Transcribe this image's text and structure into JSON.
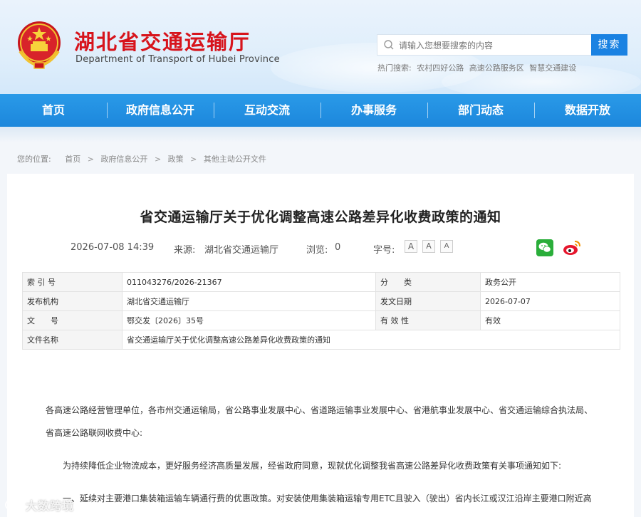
{
  "header": {
    "title": "湖北省交通运输厅",
    "subtitle": "Department of Transport of Hubei Province",
    "search_placeholder": "请输入您想要搜索的内容",
    "search_button": "搜索",
    "hot_label": "热门搜索:",
    "hot_links": [
      "农村四好公路",
      "高速公路服务区",
      "智慧交通建设"
    ]
  },
  "nav": {
    "items": [
      "首页",
      "政府信息公开",
      "互动交流",
      "办事服务",
      "部门动态",
      "数据开放"
    ]
  },
  "breadcrumb": {
    "label": "您的位置:",
    "items": [
      "首页",
      "政府信息公开",
      "政策",
      "其他主动公开文件"
    ],
    "separator": ">"
  },
  "article": {
    "title": "省交通运输厅关于优化调整高速公路差异化收费政策的通知",
    "datetime": "2026-07-08 14:39",
    "source_label": "来源:",
    "source": "湖北省交通运输厅",
    "views_label": "浏览:",
    "views": "0",
    "font_size_label": "字号:",
    "font_sizes": [
      "A",
      "A",
      "A"
    ]
  },
  "info_table": {
    "rows": [
      {
        "label": "索 引 号",
        "value": "011043276/2026-21367",
        "label2": "分　　类",
        "value2": "政务公开"
      },
      {
        "label": "发布机构",
        "value": "湖北省交通运输厅",
        "label2": "发文日期",
        "value2": "2026-07-07"
      },
      {
        "label": "文　　号",
        "value": "鄂交发〔2026〕35号",
        "label2": "有 效 性",
        "value2": "有效"
      }
    ],
    "filename_label": "文件名称",
    "filename": "省交通运输厅关于优化调整高速公路差异化收费政策的通知"
  },
  "body": {
    "p1a": "各高速公路经营管理单位，各市州交通运输局，省公路事业发展中心、省道路运输事业发展中心、省港航事业发展中心、省交通运输综合执法局、",
    "p1b": "省高速公路联网收费中心:",
    "p2": "为持续降低企业物流成本，更好服务经济高质量发展，经省政府同意，现就优化调整我省高速公路差异化收费政策有关事项通知如下:",
    "p3": "一、延续对主要港口集装箱运输车辆通行费的优惠政策。对安装使用集装箱运输专用ETC且驶入（驶出）省内长江或汉江沿岸主要港口附近高"
  },
  "watermark": {
    "text": "大数跨境"
  },
  "colors": {
    "brand_red": "#d7141c",
    "nav_blue": "#1c87dc",
    "search_blue": "#1a82e2"
  }
}
